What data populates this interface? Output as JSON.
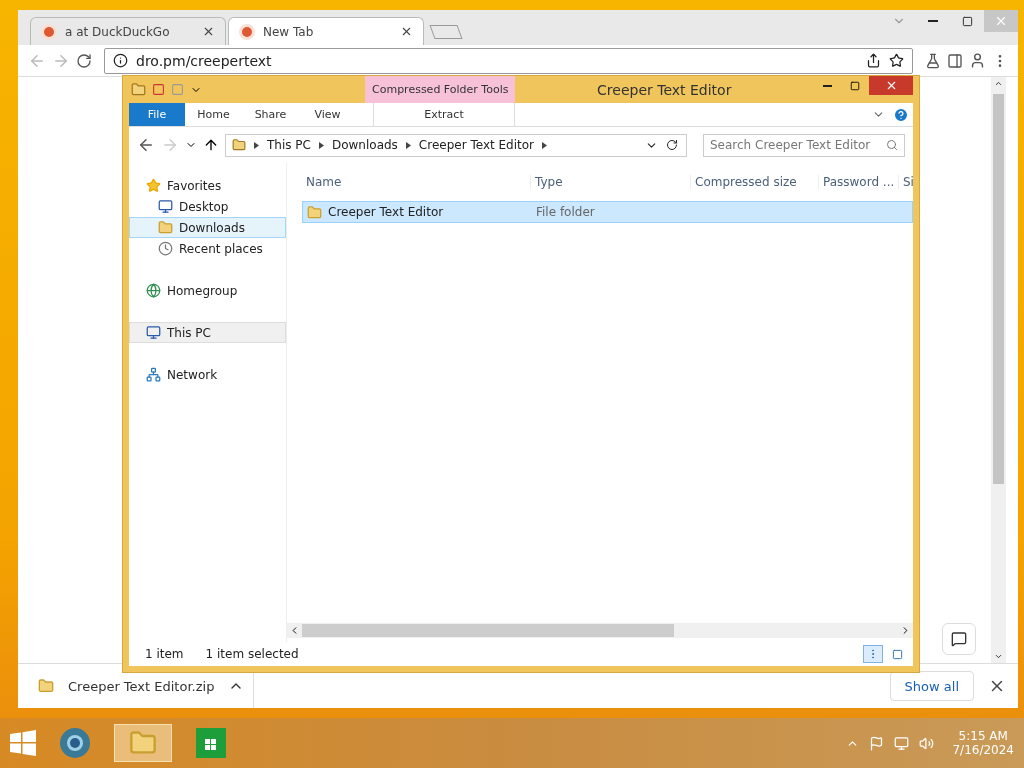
{
  "browser": {
    "tabs": [
      {
        "title": "a at DuckDuckGo",
        "selected": false
      },
      {
        "title": "New Tab",
        "selected": true
      }
    ],
    "address": "dro.pm/creepertext",
    "download": {
      "file": "Creeper Text Editor.zip",
      "button": "Show all"
    }
  },
  "explorer": {
    "title": "Creeper Text Editor",
    "contextual_tab": "Compressed Folder Tools",
    "ribbon_tabs": [
      {
        "label": "File",
        "kind": "file"
      },
      {
        "label": "Home",
        "kind": "tab"
      },
      {
        "label": "Share",
        "kind": "tab"
      },
      {
        "label": "View",
        "kind": "tab"
      },
      {
        "label": "Extract",
        "kind": "contextual"
      }
    ],
    "breadcrumb": [
      "This PC",
      "Downloads",
      "Creeper Text Editor"
    ],
    "search": {
      "placeholder": "Search Creeper Text Editor"
    },
    "nav": [
      {
        "label": "Favorites",
        "kind": "star",
        "selected": false,
        "children": [
          {
            "label": "Desktop",
            "kind": "desktop",
            "selected": false
          },
          {
            "label": "Downloads",
            "kind": "downloads",
            "selected": true
          },
          {
            "label": "Recent places",
            "kind": "recent",
            "selected": false
          }
        ]
      },
      {
        "label": "Homegroup",
        "kind": "homegroup",
        "selected": false
      },
      {
        "label": "This PC",
        "kind": "pc",
        "selected": true
      },
      {
        "label": "Network",
        "kind": "network",
        "selected": false
      }
    ],
    "columns": [
      "Name",
      "Type",
      "Compressed size",
      "Password ...",
      "Si"
    ],
    "rows": [
      {
        "name": "Creeper Text Editor",
        "type": "File folder",
        "selected": true
      }
    ],
    "status": [
      "1 item",
      "1 item selected"
    ]
  },
  "taskbar": {
    "time": "5:15 AM",
    "date": "7/16/2024"
  }
}
